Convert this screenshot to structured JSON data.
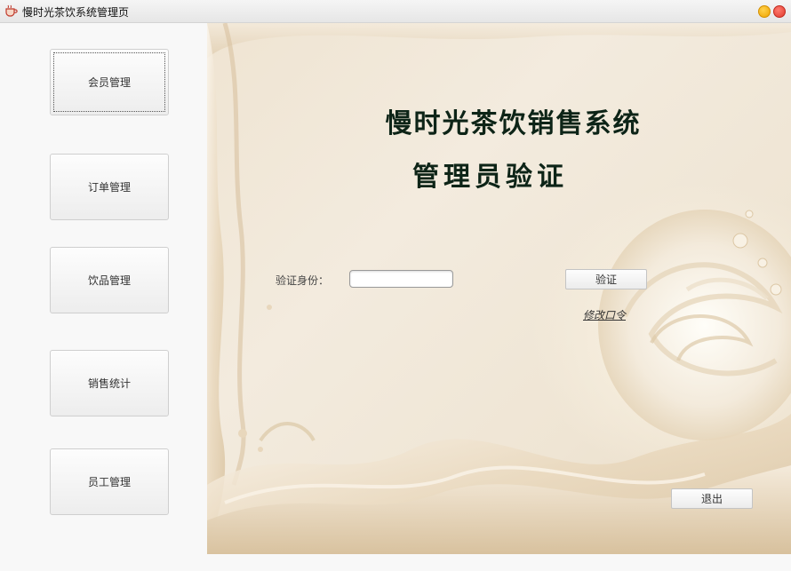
{
  "window": {
    "title": "慢时光茶饮系统管理页",
    "icon": "teacup-icon",
    "controls": [
      "minimize-button",
      "close-button"
    ]
  },
  "sidebar": {
    "items": [
      {
        "label": "会员管理",
        "active": true
      },
      {
        "label": "订单管理",
        "active": false
      },
      {
        "label": "饮品管理",
        "active": false
      },
      {
        "label": "销售统计",
        "active": false
      },
      {
        "label": "员工管理",
        "active": false
      }
    ]
  },
  "main": {
    "heading": "慢时光茶饮销售系统",
    "subheading": "管理员验证",
    "verify": {
      "label": "验证身份：",
      "input_value": "",
      "button_label": "验证"
    },
    "change_password_link": "修改口令",
    "exit_button": "退出"
  },
  "colors": {
    "heading": "#0d2417",
    "background_cream": "#efe4d2",
    "sidebar": "#f8f8f8"
  }
}
